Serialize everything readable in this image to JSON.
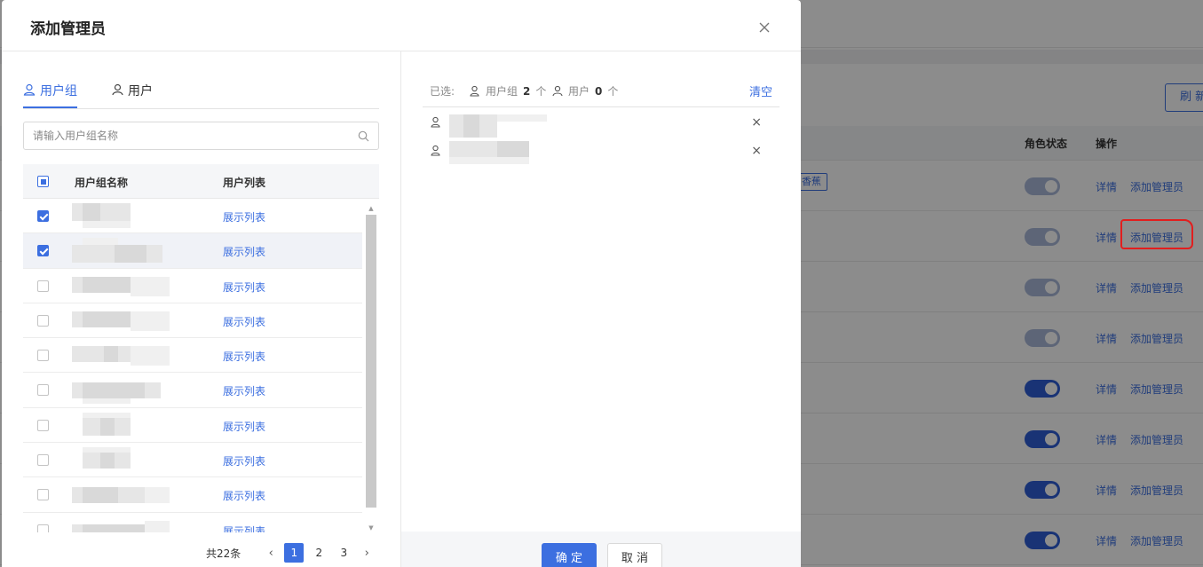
{
  "background": {
    "refresh_label": "刷 新",
    "columns": {
      "role_status": "角色状态",
      "operation": "操作"
    },
    "tag_label": "香蕉",
    "rows": [
      {
        "toggle": "off",
        "detail": "详情",
        "add_admin": "添加管理员"
      },
      {
        "toggle": "off",
        "detail": "详情",
        "add_admin": "添加管理员"
      },
      {
        "toggle": "off",
        "detail": "详情",
        "add_admin": "添加管理员"
      },
      {
        "toggle": "off",
        "detail": "详情",
        "add_admin": "添加管理员"
      },
      {
        "toggle": "on",
        "detail": "详情",
        "add_admin": "添加管理员"
      },
      {
        "toggle": "on",
        "detail": "详情",
        "add_admin": "添加管理员"
      },
      {
        "toggle": "on",
        "detail": "详情",
        "add_admin": "添加管理员"
      },
      {
        "toggle": "on",
        "detail": "详情",
        "add_admin": "添加管理员"
      }
    ]
  },
  "modal": {
    "title": "添加管理员",
    "tabs": [
      {
        "label": "用户组",
        "active": true
      },
      {
        "label": "用户",
        "active": false
      }
    ],
    "search": {
      "placeholder": "请输入用户组名称",
      "value": ""
    },
    "table": {
      "col_name": "用户组名称",
      "col_list": "用户列表",
      "rows": [
        {
          "checked": true,
          "link": "展示列表"
        },
        {
          "checked": true,
          "link": "展示列表"
        },
        {
          "checked": false,
          "link": "展示列表"
        },
        {
          "checked": false,
          "link": "展示列表"
        },
        {
          "checked": false,
          "link": "展示列表"
        },
        {
          "checked": false,
          "link": "展示列表"
        },
        {
          "checked": false,
          "link": "展示列表"
        },
        {
          "checked": false,
          "link": "展示列表"
        },
        {
          "checked": false,
          "link": "展示列表"
        },
        {
          "checked": false,
          "link": "展示列表"
        }
      ]
    },
    "pagination": {
      "total": "共22条",
      "pages": [
        "1",
        "2",
        "3"
      ],
      "current": "1"
    },
    "selected": {
      "label": "已选:",
      "group_label": "用户组",
      "group_count": "2",
      "user_label": "用户",
      "user_count": "0",
      "unit": "个",
      "clear": "清空",
      "items": [
        {
          "remove": "×"
        },
        {
          "remove": "×"
        }
      ]
    },
    "buttons": {
      "ok": "确 定",
      "cancel": "取 消"
    }
  },
  "colors": {
    "accent": "#3c6fe0",
    "highlight": "#e21e1e"
  }
}
